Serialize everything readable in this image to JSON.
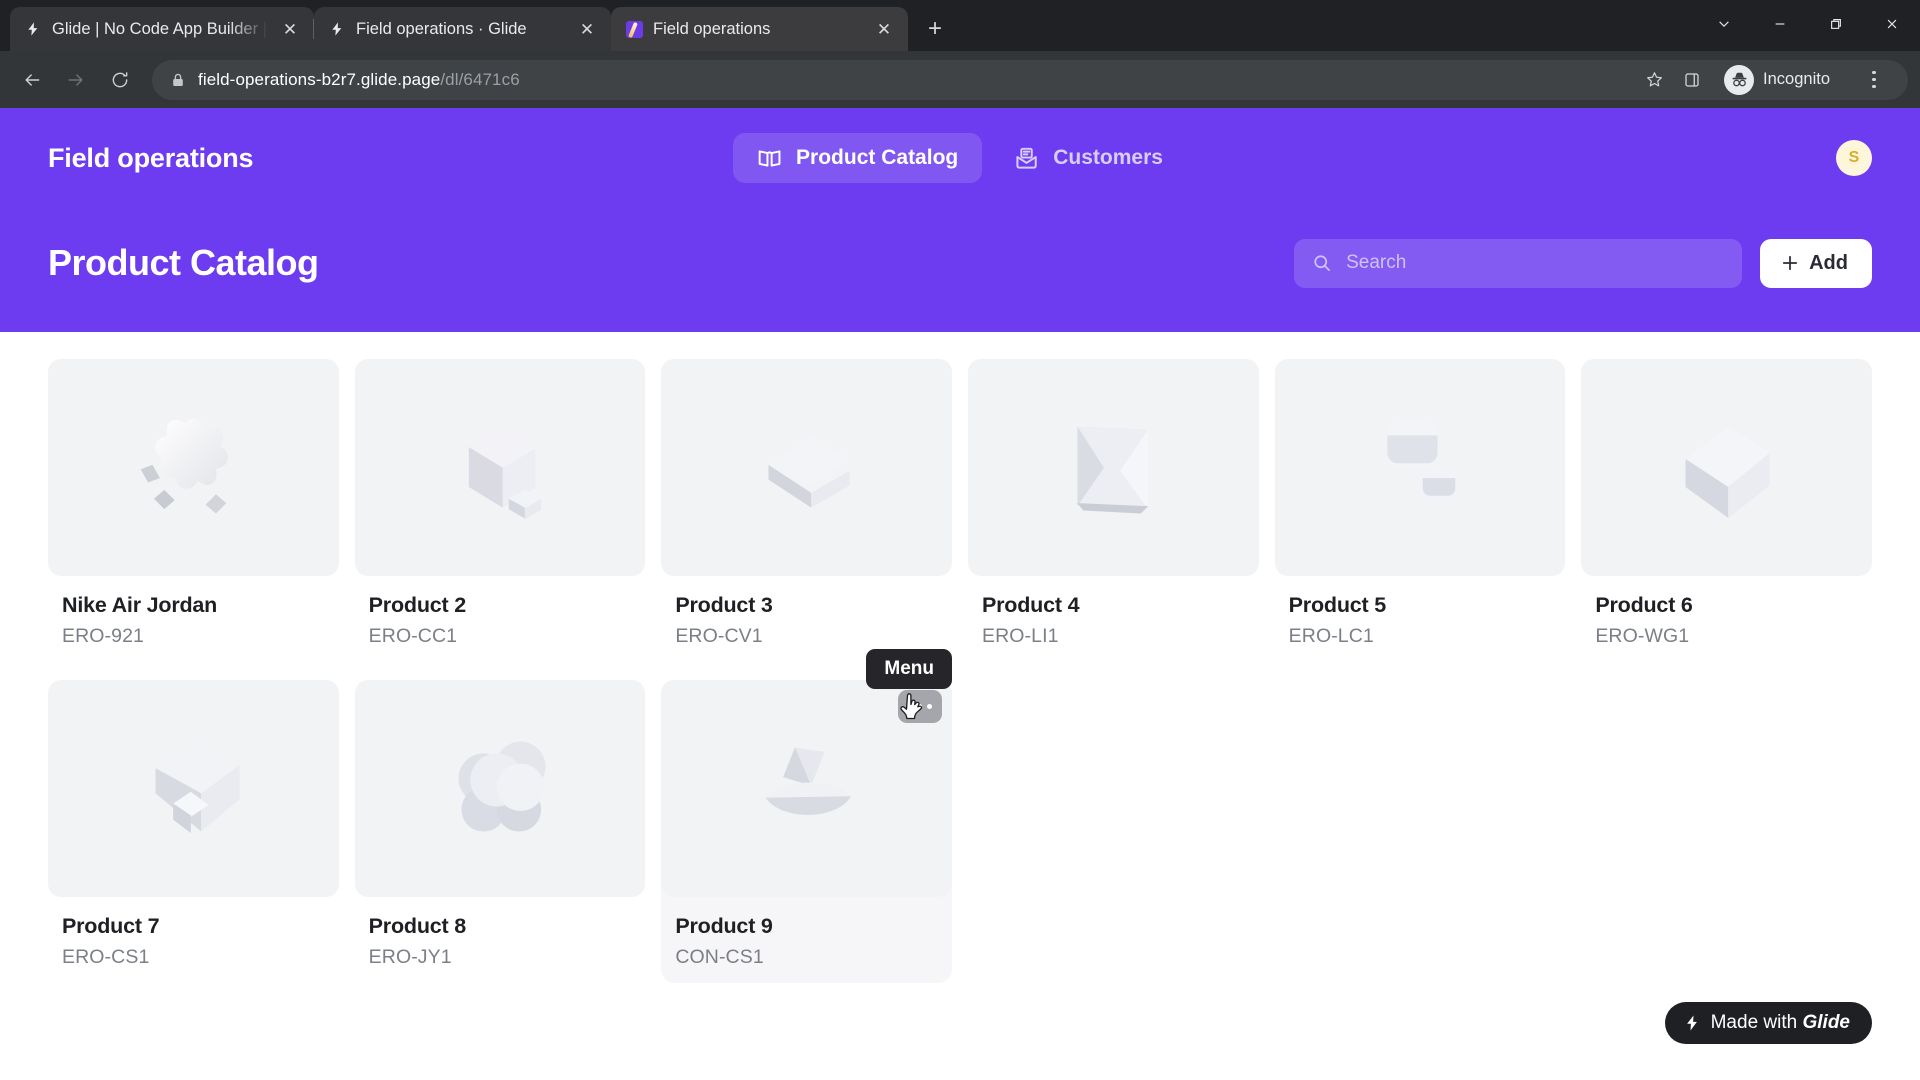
{
  "browser": {
    "tabs": [
      {
        "title": "Glide | No Code App Builder | No",
        "favicon": "glide-bolt-icon",
        "active": false
      },
      {
        "title": "Field operations · Glide",
        "favicon": "glide-bolt-icon",
        "active": false
      },
      {
        "title": "Field operations",
        "favicon": "glide-app-icon",
        "active": true
      }
    ],
    "new_tab_label": "+",
    "window_controls": [
      "chevron-down-icon",
      "minimize-icon",
      "restore-icon",
      "close-icon"
    ],
    "toolbar": {
      "back_label": "←",
      "forward_label": "→",
      "reload_label": "⟳",
      "url_domain": "field-operations-b2r7.glide.page",
      "url_path": "/dl/6471c6",
      "lock_icon": "lock-icon",
      "bookmark_icon": "star-icon",
      "sidepanel_icon": "side-panel-icon",
      "profile_label": "Incognito",
      "menu_icon": "three-dot-menu-icon"
    }
  },
  "app": {
    "title": "Field operations",
    "nav": [
      {
        "label": "Product Catalog",
        "icon": "book-open-icon",
        "active": true
      },
      {
        "label": "Customers",
        "icon": "mail-document-icon",
        "active": false
      }
    ],
    "avatar_initial": "S",
    "page_title": "Product Catalog",
    "search": {
      "placeholder": "Search",
      "value": "",
      "icon": "search-icon"
    },
    "add_button": {
      "label": "Add",
      "icon": "plus-icon"
    },
    "tooltip_label": "Menu",
    "glide_badge": {
      "prefix": "Made with ",
      "brand": "Glide",
      "icon": "glide-bolt-icon"
    },
    "colors": {
      "brand_purple": "#6d3cf0",
      "tile_gray": "#f2f3f5",
      "text_primary": "#1f2024",
      "text_secondary": "#7b7f88",
      "tooltip_bg": "#26262a",
      "avatar_bg": "#fdf6da",
      "avatar_fg": "#d9ad2b"
    },
    "products": [
      {
        "name": "Nike Air Jordan",
        "sku": "ERO-921",
        "shape": "flower-gear",
        "hovered": false
      },
      {
        "name": "Product 2",
        "sku": "ERO-CC1",
        "shape": "cube-and-wedge",
        "hovered": false
      },
      {
        "name": "Product 3",
        "sku": "ERO-CV1",
        "shape": "tilted-slab",
        "hovered": false
      },
      {
        "name": "Product 4",
        "sku": "ERO-LI1",
        "shape": "hourglass-prism",
        "hovered": false
      },
      {
        "name": "Product 5",
        "sku": "ERO-LC1",
        "shape": "two-rounded-cubes",
        "hovered": false
      },
      {
        "name": "Product 6",
        "sku": "ERO-WG1",
        "shape": "rotated-cube",
        "hovered": false
      },
      {
        "name": "Product 7",
        "sku": "ERO-CS1",
        "shape": "notched-block",
        "hovered": false
      },
      {
        "name": "Product 8",
        "sku": "ERO-JY1",
        "shape": "clover-cluster",
        "hovered": false
      },
      {
        "name": "Product 9",
        "sku": "CON-CS1",
        "shape": "dome-and-wedge",
        "hovered": true
      }
    ]
  }
}
